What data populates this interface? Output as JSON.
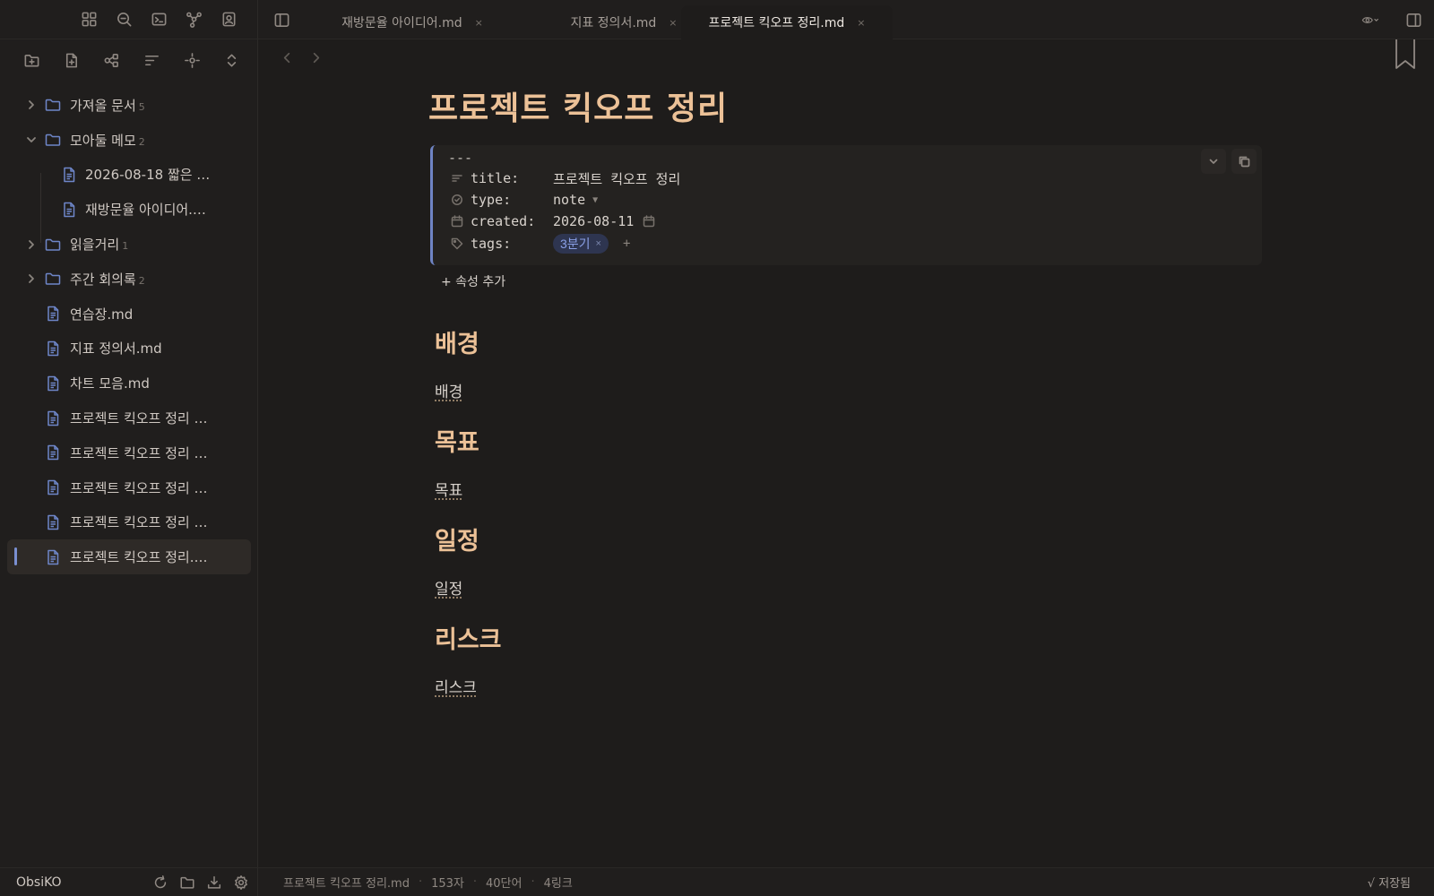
{
  "sidebar": {
    "ribbon_icons": [
      "layout-grid-icon",
      "search-icon",
      "terminal-icon",
      "graph-icon",
      "contact-icon"
    ],
    "tools": [
      "new-folder-icon",
      "new-note-icon",
      "graph-view-icon",
      "sort-icon",
      "reveal-icon",
      "expand-collapse-icon"
    ],
    "tree": [
      {
        "label": "가져올 문서",
        "count": "5",
        "type": "folder",
        "expanded": false
      },
      {
        "label": "모아둘 메모",
        "count": "2",
        "type": "folder",
        "expanded": true
      },
      {
        "label": "2026-08-18 짧은 …",
        "type": "file",
        "indent": true
      },
      {
        "label": "재방문율 아이디어.…",
        "type": "file",
        "indent": true
      },
      {
        "label": "읽을거리",
        "count": "1",
        "type": "folder",
        "expanded": false
      },
      {
        "label": "주간 회의록",
        "count": "2",
        "type": "folder",
        "expanded": false
      },
      {
        "label": "연습장.md",
        "type": "file"
      },
      {
        "label": "지표 정의서.md",
        "type": "file"
      },
      {
        "label": "차트 모음.md",
        "type": "file"
      },
      {
        "label": "프로젝트 킥오프 정리 …",
        "type": "file"
      },
      {
        "label": "프로젝트 킥오프 정리 …",
        "type": "file"
      },
      {
        "label": "프로젝트 킥오프 정리 …",
        "type": "file"
      },
      {
        "label": "프로젝트 킥오프 정리 …",
        "type": "file"
      },
      {
        "label": "프로젝트 킥오프 정리.…",
        "type": "file",
        "active": true
      }
    ],
    "vault_name": "ObsiKO"
  },
  "tabs": [
    {
      "label": "재방문율 아이디어.md",
      "close": "×"
    },
    {
      "label": "지표 정의서.md",
      "close": "×"
    },
    {
      "label": "프로젝트 킥오프 정리.md",
      "close": "×",
      "active": true
    }
  ],
  "doc": {
    "title": "프로젝트 킥오프 정리",
    "frontmatter_delim": "---",
    "props": [
      {
        "key": "title:",
        "value": "프로젝트 킥오프 정리",
        "icon": "text-icon"
      },
      {
        "key": "type:",
        "value": "note",
        "icon": "circle-check-icon"
      },
      {
        "key": "created:",
        "value": "2026-08-11",
        "icon": "calendar-icon"
      },
      {
        "key": "tags:",
        "value": "3분기",
        "icon": "tag-icon"
      }
    ],
    "tag_remove": "×",
    "tag_add": "+",
    "add_property": "+ 속성 추가",
    "sections": [
      {
        "heading": "배경",
        "link": "배경"
      },
      {
        "heading": "목표",
        "link": "목표"
      },
      {
        "heading": "일정",
        "link": "일정"
      },
      {
        "heading": "리스크",
        "link": "리스크"
      }
    ]
  },
  "status": {
    "filename": "프로젝트 킥오프 정리.md",
    "chars": "153자",
    "words": "40단어",
    "links": "4링크",
    "saved": "√ 저장됨"
  },
  "colors": {
    "accent": "#7a8fd0",
    "heading": "#ecc197",
    "tag_bg": "#2e3550"
  }
}
